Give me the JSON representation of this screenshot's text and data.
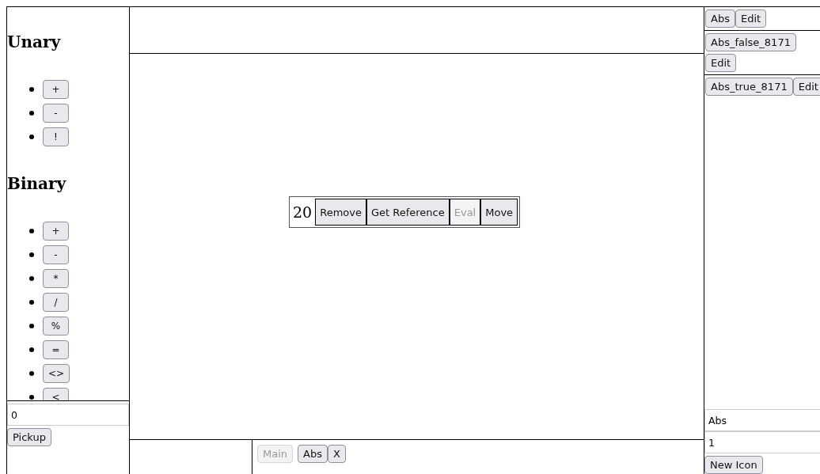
{
  "operators": {
    "sections": [
      {
        "title": "Unary",
        "items": [
          "+",
          "-",
          "!"
        ]
      },
      {
        "title": "Binary",
        "items": [
          "+",
          "-",
          "*",
          "/",
          "%",
          "=",
          "<>",
          "<"
        ]
      }
    ]
  },
  "pickup": {
    "value": "0",
    "button": "Pickup"
  },
  "canvas": {
    "node": {
      "value": "20",
      "buttons": [
        {
          "label": "Remove",
          "disabled": false
        },
        {
          "label": "Get Reference",
          "disabled": false
        },
        {
          "label": "Eval",
          "disabled": true
        },
        {
          "label": "Move",
          "disabled": false
        }
      ]
    }
  },
  "tabs": [
    {
      "label": "Main",
      "disabled": true
    },
    {
      "label": "Abs",
      "disabled": false,
      "close": "X"
    }
  ],
  "signatures": [
    {
      "name": "Abs",
      "edit": "Edit"
    }
  ],
  "cases": [
    {
      "name": "Abs_false_8171",
      "edit": "Edit"
    }
  ],
  "instances": [
    {
      "name": "Abs_true_8171",
      "edit": "Edit"
    }
  ],
  "new_icon": {
    "name": "Abs",
    "count": "1",
    "button": "New Icon"
  }
}
